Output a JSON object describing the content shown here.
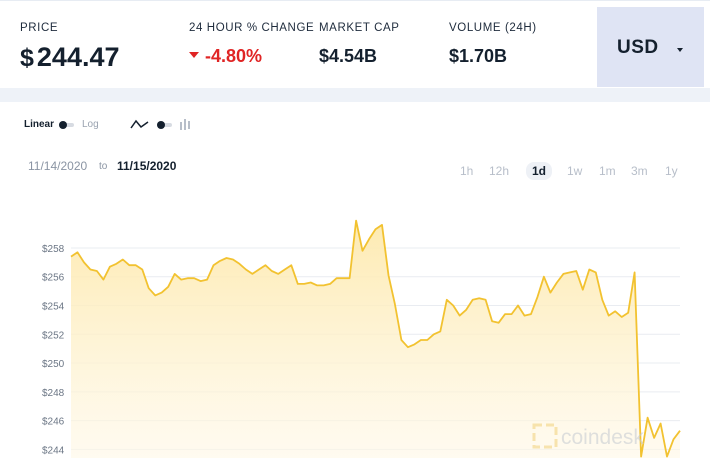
{
  "stats": {
    "price": {
      "label": "PRICE",
      "currency_symbol": "$",
      "value": "244.47"
    },
    "change": {
      "label": "24 HOUR % CHANGE",
      "value": "-4.80%"
    },
    "market_cap": {
      "label": "MARKET CAP",
      "value": "$4.54B"
    },
    "volume": {
      "label": "VOLUME (24H)",
      "value": "$1.70B"
    }
  },
  "currency_selector": {
    "label": "USD"
  },
  "scale_toggle": {
    "linear_label": "Linear",
    "log_label": "Log"
  },
  "date_range": {
    "from": "11/14/2020",
    "to_word": "to",
    "to": "11/15/2020"
  },
  "ranges": [
    "1h",
    "12h",
    "1d",
    "1w",
    "1m",
    "3m",
    "1y"
  ],
  "selected_range": "1d",
  "watermark": "coindesk",
  "colors": {
    "line": "#f2c230",
    "fill_top": "#fde9ad",
    "negative": "#e02424",
    "currency_bg": "#dfe4f4"
  },
  "chart_data": {
    "type": "area",
    "y_ticks": [
      "$244",
      "$246",
      "$248",
      "$250",
      "$252",
      "$254",
      "$256",
      "$258"
    ],
    "ylim": [
      243.4,
      260.5
    ],
    "values": [
      257.4,
      257.7,
      257.0,
      256.5,
      256.4,
      255.8,
      256.7,
      256.9,
      257.2,
      256.8,
      256.8,
      256.5,
      255.2,
      254.7,
      254.9,
      255.3,
      256.2,
      255.8,
      255.9,
      255.9,
      255.7,
      255.8,
      256.8,
      257.1,
      257.3,
      257.2,
      256.9,
      256.5,
      256.2,
      256.5,
      256.8,
      256.4,
      256.2,
      256.5,
      256.8,
      255.5,
      255.5,
      255.6,
      255.4,
      255.4,
      255.5,
      255.9,
      255.9,
      255.9,
      259.9,
      257.8,
      258.6,
      259.3,
      259.6,
      256.1,
      254.1,
      251.6,
      251.1,
      251.3,
      251.6,
      251.6,
      252.0,
      252.2,
      254.4,
      254.0,
      253.3,
      253.7,
      254.4,
      254.5,
      254.4,
      252.9,
      252.8,
      253.4,
      253.4,
      254.0,
      253.3,
      253.4,
      254.6,
      256.0,
      254.9,
      255.6,
      256.2,
      256.3,
      256.4,
      255.1,
      256.5,
      256.3,
      254.4,
      253.3,
      253.6,
      253.2,
      253.5,
      256.3,
      243.5,
      246.2,
      244.8,
      245.8,
      243.5,
      244.7,
      245.3
    ]
  }
}
